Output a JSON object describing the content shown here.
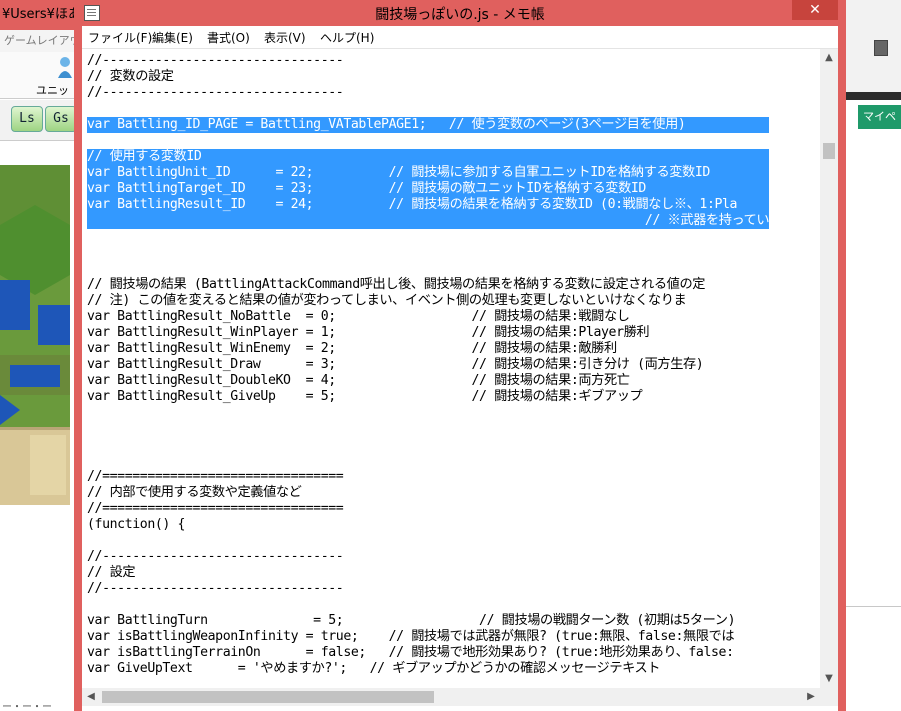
{
  "background_app": {
    "title": "¥Users¥ほあ",
    "menu": "ゲームレイアウ",
    "unit_label": "ユニッ",
    "buttons": [
      "Ls",
      "Gs"
    ],
    "lower_text": "ー・ー・ー"
  },
  "right_app": {
    "green_label": "マイペ"
  },
  "notepad": {
    "title": "闘技場っぽいの.js - メモ帳",
    "close_glyph": "✕",
    "menu": [
      "ファイル(F)",
      "編集(E)",
      "書式(O)",
      "表示(V)",
      "ヘルプ(H)"
    ],
    "lines": [
      {
        "text": "//--------------------------------",
        "selected": false
      },
      {
        "text": "// 変数の設定",
        "selected": false
      },
      {
        "text": "//--------------------------------",
        "selected": false
      },
      {
        "text": "",
        "selected": false
      },
      {
        "text": "var Battling_ID_PAGE = Battling_VATablePAGE1;   // 使う変数のページ(3ページ目を使用)",
        "selected": true
      },
      {
        "text": "",
        "selected": false
      },
      {
        "text": "// 使用する変数ID",
        "selected": true
      },
      {
        "text": "var BattlingUnit_ID      = 22;          // 闘技場に参加する自軍ユニットIDを格納する変数ID",
        "selected": true
      },
      {
        "text": "var BattlingTarget_ID    = 23;          // 闘技場の敵ユニットIDを格納する変数ID",
        "selected": true
      },
      {
        "text": "var BattlingResult_ID    = 24;          // 闘技場の結果を格納する変数ID (0:戦闘なし※、1:Pla",
        "selected": true
      },
      {
        "text": "                                                                          // ※武器を持ってい",
        "selected": true
      },
      {
        "text": "",
        "selected": false
      },
      {
        "text": "",
        "selected": false
      },
      {
        "text": "",
        "selected": false
      },
      {
        "text": "// 闘技場の結果 (BattlingAttackCommand呼出し後、闘技場の結果を格納する変数に設定される値の定",
        "selected": false
      },
      {
        "text": "// 注) この値を変えると結果の値が変わってしまい、イベント側の処理も変更しないといけなくなりま",
        "selected": false
      },
      {
        "text": "var BattlingResult_NoBattle  = 0;                  // 闘技場の結果:戦闘なし",
        "selected": false
      },
      {
        "text": "var BattlingResult_WinPlayer = 1;                  // 闘技場の結果:Player勝利",
        "selected": false
      },
      {
        "text": "var BattlingResult_WinEnemy  = 2;                  // 闘技場の結果:敵勝利",
        "selected": false
      },
      {
        "text": "var BattlingResult_Draw      = 3;                  // 闘技場の結果:引き分け (両方生存)",
        "selected": false
      },
      {
        "text": "var BattlingResult_DoubleKO  = 4;                  // 闘技場の結果:両方死亡",
        "selected": false
      },
      {
        "text": "var BattlingResult_GiveUp    = 5;                  // 闘技場の結果:ギブアップ",
        "selected": false
      },
      {
        "text": "",
        "selected": false
      },
      {
        "text": "",
        "selected": false
      },
      {
        "text": "",
        "selected": false
      },
      {
        "text": "",
        "selected": false
      },
      {
        "text": "//================================",
        "selected": false
      },
      {
        "text": "// 内部で使用する変数や定義値など",
        "selected": false
      },
      {
        "text": "//================================",
        "selected": false
      },
      {
        "text": "(function() {",
        "selected": false
      },
      {
        "text": "",
        "selected": false
      },
      {
        "text": "//--------------------------------",
        "selected": false
      },
      {
        "text": "// 設定",
        "selected": false
      },
      {
        "text": "//--------------------------------",
        "selected": false
      },
      {
        "text": "",
        "selected": false
      },
      {
        "text": "var BattlingTurn              = 5;                  // 闘技場の戦闘ターン数 (初期は5ターン)",
        "selected": false
      },
      {
        "text": "var isBattlingWeaponInfinity = true;    // 闘技場では武器が無限? (true:無限、false:無限では",
        "selected": false
      },
      {
        "text": "var isBattlingTerrainOn      = false;   // 闘技場で地形効果あり? (true:地形効果あり、false:",
        "selected": false
      },
      {
        "text": "var GiveUpText      = 'やめますか?';   // ギブアップかどうかの確認メッセージテキスト",
        "selected": false
      }
    ],
    "scroll_icons": {
      "up": "▲",
      "down": "▼",
      "left": "◀",
      "right": "▶"
    }
  },
  "colors": {
    "titlebar": "#e0605e",
    "selection": "#3399ff",
    "close_button": "#c7443d"
  }
}
